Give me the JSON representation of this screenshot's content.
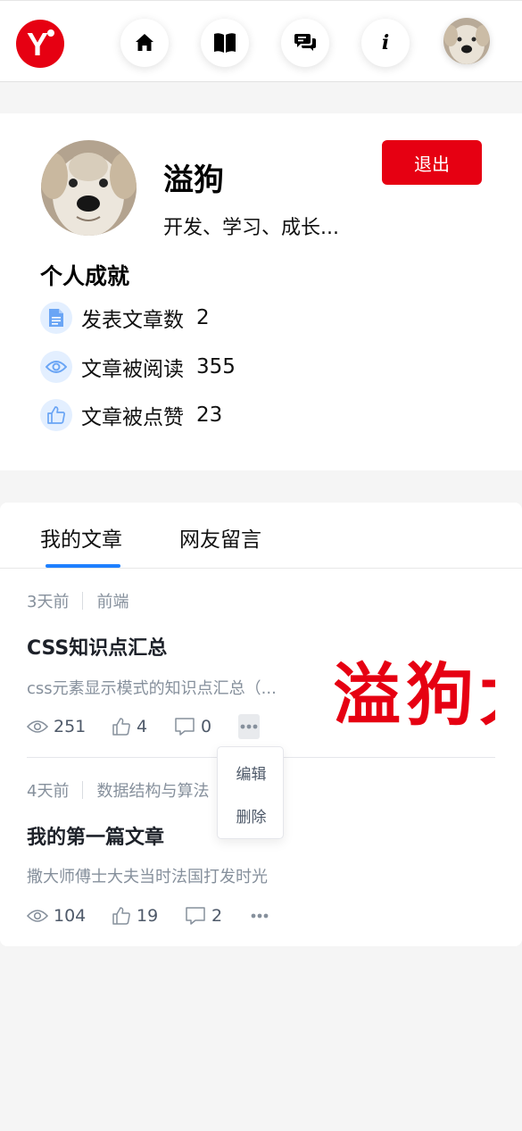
{
  "nav": {
    "logo_letter": "Y",
    "items": [
      {
        "name": "home",
        "icon": "home-icon"
      },
      {
        "name": "books",
        "icon": "book-icon"
      },
      {
        "name": "messages",
        "icon": "chat-icon"
      },
      {
        "name": "about",
        "icon": "info-icon",
        "glyph": "i"
      }
    ],
    "avatar_icon": "user-avatar"
  },
  "profile": {
    "username": "溢狗",
    "bio": "开发、学习、成长...",
    "logout_label": "退出",
    "achievements_title": "个人成就",
    "achievements": [
      {
        "label": "发表文章数",
        "value": "2",
        "icon": "document-icon"
      },
      {
        "label": "文章被阅读",
        "value": "355",
        "icon": "eye-icon"
      },
      {
        "label": "文章被点赞",
        "value": "23",
        "icon": "thumbs-up-icon"
      }
    ]
  },
  "tabs": [
    {
      "label": "我的文章",
      "active": true
    },
    {
      "label": "网友留言",
      "active": false
    }
  ],
  "articles": [
    {
      "time": "3天前",
      "category": "前端",
      "title": "CSS知识点汇总",
      "desc": "css元素显示模式的知识点汇总（...",
      "views": "251",
      "likes": "4",
      "comments": "0",
      "thumbnail_text": "溢狗大"
    },
    {
      "time": "4天前",
      "category": "数据结构与算法",
      "title": "我的第一篇文章",
      "desc": "撒大师傅士大夫当时法国打发时光",
      "views": "104",
      "likes": "19",
      "comments": "2"
    }
  ],
  "menu": {
    "edit_label": "编辑",
    "delete_label": "删除"
  },
  "colors": {
    "brand": "#e60012",
    "accent": "#1e80ff",
    "icon_bg": "#e3efff",
    "icon_fg": "#6aa5f5"
  }
}
